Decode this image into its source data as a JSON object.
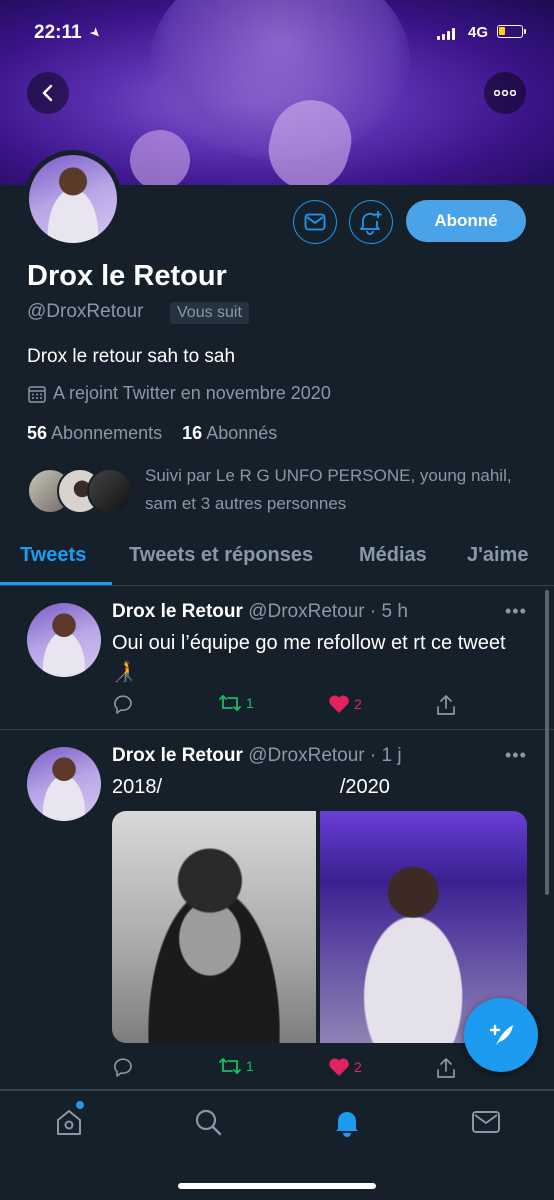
{
  "status_bar": {
    "time": "22:11",
    "network": "4G"
  },
  "profile": {
    "name": "Drox le Retour",
    "handle": "@DroxRetour",
    "follows_you": "Vous suit",
    "bio": "Drox le retour sah to sah",
    "joined": "A rejoint Twitter en novembre 2020",
    "following_count": "56",
    "following_label": "Abonnements",
    "followers_count": "16",
    "followers_label": "Abonnés",
    "followed_by": "Suivi par Le R G UNFO PERSONE, young nahil, sam et 3 autres personnes",
    "follow_button": "Abonné"
  },
  "tabs": [
    {
      "label": "Tweets"
    },
    {
      "label": "Tweets et réponses"
    },
    {
      "label": "Médias"
    },
    {
      "label": "J'aime"
    }
  ],
  "tweets": [
    {
      "name": "Drox le Retour",
      "meta": "@DroxRetour · 5 h",
      "text": "Oui oui l’équipe go me refollow et rt ce tweet 🧑‍🦯",
      "retweets": "1",
      "likes": "2"
    },
    {
      "name": "Drox le Retour",
      "meta": "@DroxRetour · 1 j",
      "text": "2018/                                /2020",
      "retweets": "1",
      "likes": "2"
    }
  ],
  "colors": {
    "accent": "#1d9bf0",
    "background": "#15202b",
    "retweet": "#17bf63",
    "like": "#e0245e",
    "muted": "#8899a6"
  },
  "icons": {
    "back": "chevron-left-icon",
    "more": "more-horizontal-icon",
    "mail": "mail-icon",
    "bell": "bell-plus-icon",
    "calendar": "calendar-icon",
    "reply": "reply-icon",
    "retweet": "retweet-icon",
    "like": "heart-icon",
    "share": "share-icon",
    "compose": "compose-icon",
    "home": "home-icon",
    "search": "search-icon",
    "notifications": "bell-icon",
    "messages": "mail-icon"
  }
}
